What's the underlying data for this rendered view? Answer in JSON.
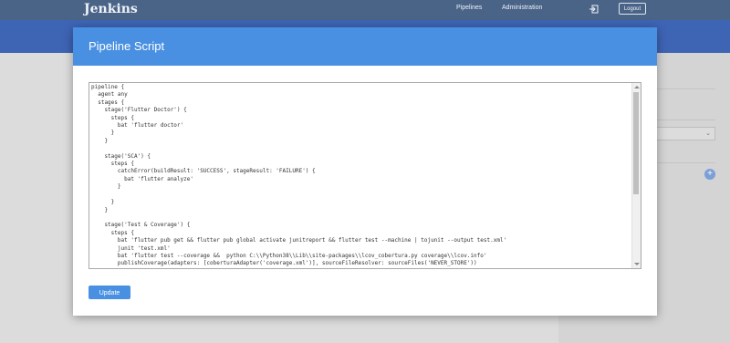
{
  "app": {
    "brand": "Jenkins",
    "nav": [
      "Pipelines",
      "Administration"
    ],
    "logout_label": "Logout"
  },
  "modal": {
    "title": "Pipeline Script",
    "script": "pipeline {\n  agent any\n  stages {\n    stage('Flutter Doctor') {\n      steps {\n        bat 'flutter doctor'\n      }\n    }\n\n    stage('SCA') {\n      steps {\n        catchError(buildResult: 'SUCCESS', stageResult: 'FAILURE') {\n          bat 'flutter analyze'\n        }\n\n      }\n    }\n\n    stage('Test & Coverage') {\n      steps {\n        bat 'flutter pub get && flutter pub global activate junitreport && flutter test --machine | tojunit --output test.xml'\n        junit 'test.xml'\n        bat 'flutter test --coverage &&  python C:\\\\Python38\\\\Lib\\\\site-packages\\\\lcov_cobertura.py coverage\\\\lcov.info'\n        publishCoverage(adapters: [coberturaAdapter('coverage.xml')], sourceFileResolver: sourceFiles('NEVER_STORE'))\n      }",
    "update_label": "Update"
  },
  "colors": {
    "topbar": "#4a6488",
    "header_band": "#3e64b4",
    "modal_header": "#4a90e2",
    "button": "#4a90e2"
  }
}
